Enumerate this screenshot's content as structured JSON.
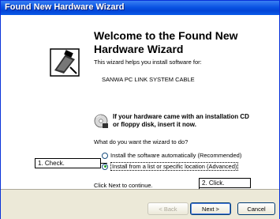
{
  "window": {
    "title": "Found New Hardware Wizard"
  },
  "heading": "Welcome to the Found New Hardware Wizard",
  "intro": "This wizard helps you install software for:",
  "device": "SANWA PC LINK SYSTEM CABLE",
  "cd_prompt_line1": "If your hardware came with an installation CD",
  "cd_prompt_line2": "or floppy disk, insert it now.",
  "question": "What do you want the wizard to do?",
  "options": [
    {
      "label": "Install the software automatically (Recommended)",
      "selected": false
    },
    {
      "label": "Install from a list or specific location (Advanced)",
      "selected": true
    }
  ],
  "continue_text": "Click Next to continue.",
  "callouts": {
    "check": "1. Check.",
    "click": "2. Click."
  },
  "buttons": {
    "back": "< Back",
    "next": "Next >",
    "cancel": "Cancel"
  }
}
